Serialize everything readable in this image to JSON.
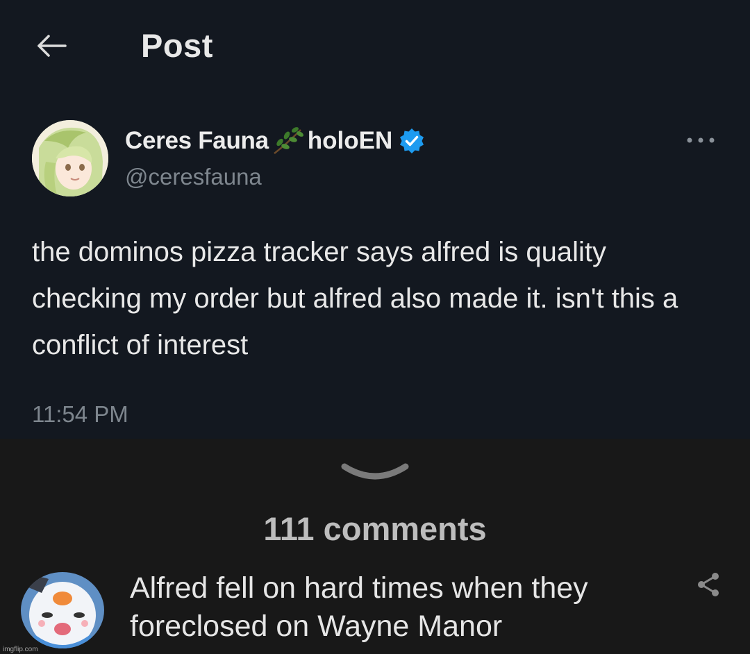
{
  "header": {
    "title": "Post",
    "back_icon": "arrow-left-icon"
  },
  "tweet": {
    "display_name": "Ceres Fauna",
    "name_emoji": "herb-icon",
    "org_name": "holoEN",
    "verified_icon": "verified-badge-icon",
    "handle": "@ceresfauna",
    "text": "the dominos pizza tracker says alfred is quality checking my order but alfred also made it. isn't this a conflict of interest",
    "time": "11:54 PM",
    "more_icon": "more-horizontal-icon"
  },
  "comments": {
    "count_label": "111 comments",
    "expand_icon": "chevron-down-icon",
    "first": {
      "text": "Alfred fell on hard times when they foreclosed on Wayne Manor",
      "share_icon": "share-icon"
    }
  },
  "watermark": "imgflip.com",
  "colors": {
    "tweet_bg": "#131820",
    "comment_bg": "#181818",
    "verified_blue": "#1d9bf0",
    "muted_text": "#7e868e",
    "leaf_green": "#3d7a2a"
  }
}
